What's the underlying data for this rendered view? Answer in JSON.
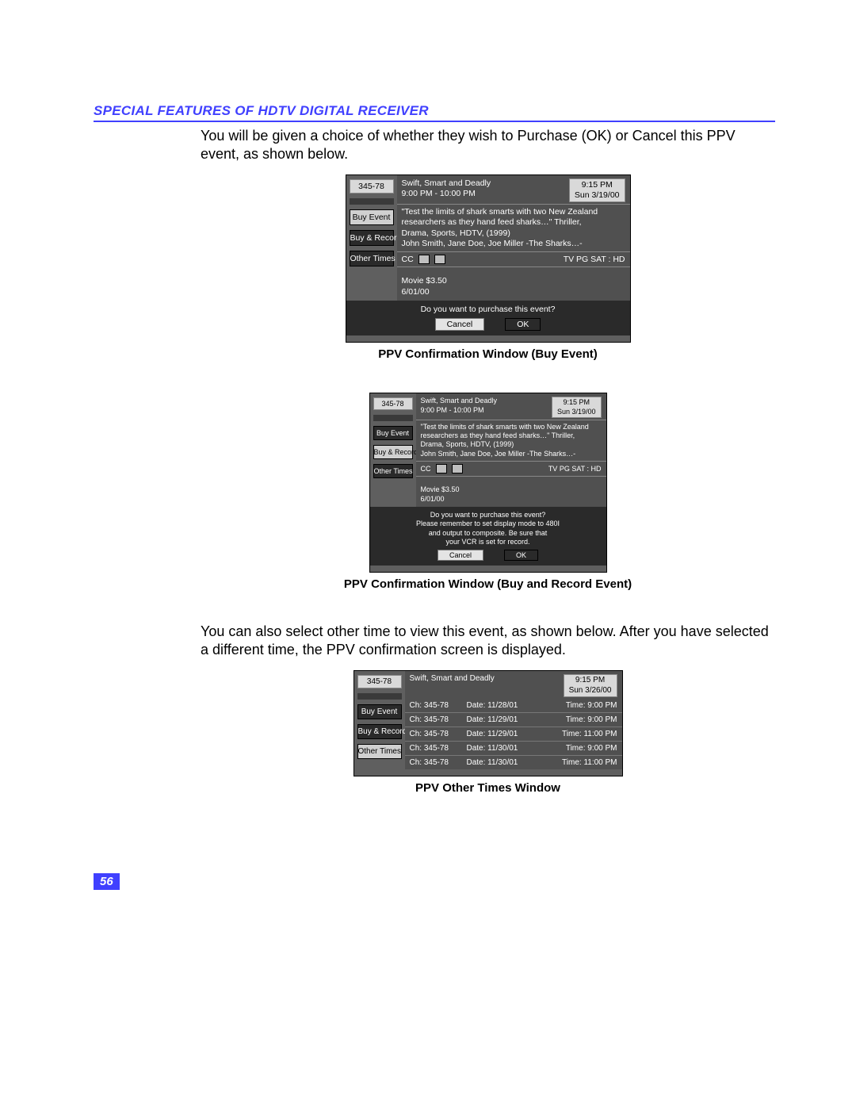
{
  "header": "SPECIAL FEATURES OF HDTV DIGITAL RECEIVER",
  "intro": "You will be given a choice of whether they wish to Purchase (OK) or Cancel this PPV event, as shown below.",
  "midtext": "You can also select other time to view this event, as shown below. After you have selected a different time, the PPV confirmation screen is displayed.",
  "page_number": "56",
  "captions": {
    "fig1": "PPV Confirmation Window (Buy Event)",
    "fig2": "PPV Confirmation Window (Buy and Record Event)",
    "fig3": "PPV Other Times Window"
  },
  "common": {
    "channel": "345-78",
    "title": "Swift, Smart and Deadly",
    "slot": "9:00 PM - 10:00 PM",
    "clock_time": "9:15 PM",
    "desc_l1": "\"Test the limits of shark smarts with two New Zealand",
    "desc_l2": "researchers as they hand feed sharks…\" Thriller,",
    "desc_l3": "Drama, Sports, HDTV, (1999)",
    "desc_l4": "John Smith, Jane Doe, Joe Miller -The Sharks…-",
    "cc": "CC",
    "rating": "TV PG   SAT : HD",
    "price_line": "Movie   $3.50",
    "date_line": "6/01/00",
    "sidebar": {
      "buy": "Buy Event",
      "buyrec": "Buy & Record",
      "other": "Other Times"
    },
    "buttons": {
      "cancel": "Cancel",
      "ok": "OK"
    }
  },
  "fig1": {
    "clock_date": "Sun 3/19/00",
    "prompt": "Do you want to purchase this event?"
  },
  "fig2": {
    "clock_date": "Sun 3/19/00",
    "prompt_l1": "Do you want to purchase this event?",
    "prompt_l2": "Please remember to set display mode to 480I",
    "prompt_l3": "and output to composite.  Be sure that",
    "prompt_l4": "your VCR is set for record."
  },
  "fig3": {
    "clock_date": "Sun 3/26/00",
    "rows": [
      {
        "ch": "Ch: 345-78",
        "date": "Date: 11/28/01",
        "time": "Time:   9:00 PM"
      },
      {
        "ch": "Ch: 345-78",
        "date": "Date: 11/29/01",
        "time": "Time:   9:00 PM"
      },
      {
        "ch": "Ch: 345-78",
        "date": "Date: 11/29/01",
        "time": "Time: 11:00 PM"
      },
      {
        "ch": "Ch: 345-78",
        "date": "Date: 11/30/01",
        "time": "Time:   9:00 PM"
      },
      {
        "ch": "Ch: 345-78",
        "date": "Date: 11/30/01",
        "time": "Time: 11:00 PM"
      }
    ]
  }
}
